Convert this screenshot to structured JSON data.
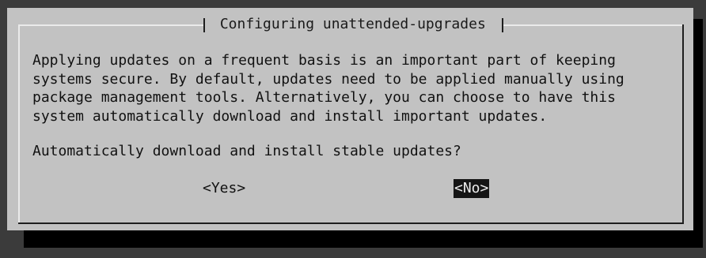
{
  "dialog": {
    "title": " Configuring unattended-upgrades ",
    "message_lines": [
      "Applying updates on a frequent basis is an important part of keeping",
      "systems secure. By default, updates need to be applied manually using",
      "package management tools. Alternatively, you can choose to have this",
      "system automatically download and install important updates."
    ],
    "question": "Automatically download and install stable updates?",
    "buttons": {
      "yes_label": "<Yes>",
      "no_label": "<No>",
      "selected": "no"
    }
  },
  "colors": {
    "background": "#3b3b3b",
    "dialog_background": "#c2c2c2",
    "shadow": "#000000",
    "selected_button_bg": "#151515",
    "selected_button_fg": "#ededed",
    "text": "#111111"
  }
}
